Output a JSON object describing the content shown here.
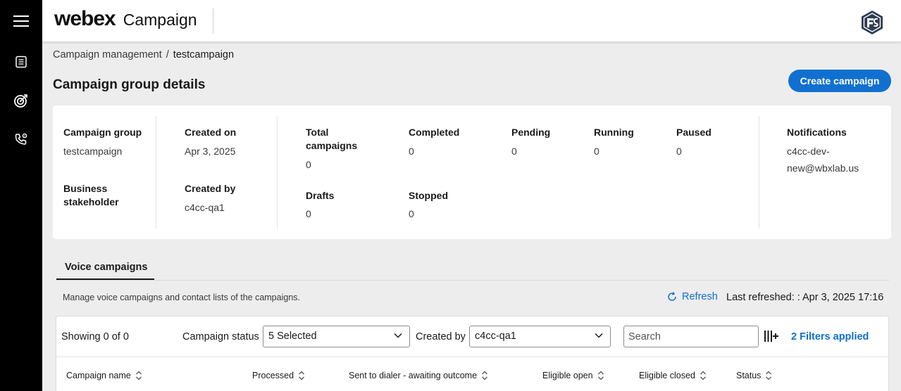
{
  "app": {
    "logo": "webex",
    "product": "Campaign"
  },
  "rail": {
    "items": [
      {
        "icon": "menu-icon"
      },
      {
        "icon": "list-icon"
      },
      {
        "icon": "target-icon"
      },
      {
        "icon": "phone-settings-icon"
      }
    ]
  },
  "breadcrumb": {
    "parent": "Campaign management",
    "separator": "/",
    "current": "testcampaign"
  },
  "page": {
    "title": "Campaign group details",
    "create_button": "Create campaign"
  },
  "details": {
    "campaign_group_label": "Campaign group",
    "campaign_group_value": "testcampaign",
    "business_stakeholder_label_1": "Business",
    "business_stakeholder_label_2": "stakeholder",
    "created_on_label": "Created on",
    "created_on_value": "Apr 3, 2025",
    "created_by_label": "Created by",
    "created_by_value": "c4cc-qa1",
    "total_label_1": "Total",
    "total_label_2": "campaigns",
    "total_value": "0",
    "completed_label": "Completed",
    "completed_value": "0",
    "pending_label": "Pending",
    "pending_value": "0",
    "running_label": "Running",
    "running_value": "0",
    "paused_label": "Paused",
    "paused_value": "0",
    "drafts_label": "Drafts",
    "drafts_value": "0",
    "stopped_label": "Stopped",
    "stopped_value": "0",
    "notifications_label": "Notifications",
    "notifications_value_1": "c4cc-dev-",
    "notifications_value_2": "new@wbxlab.us"
  },
  "tabs": {
    "active": "Voice campaigns"
  },
  "list": {
    "description": "Manage voice campaigns and contact lists of the campaigns.",
    "refresh_label": "Refresh",
    "last_refreshed": "Last refreshed: : Apr 3, 2025 17:16",
    "showing": "Showing 0 of 0",
    "status_filter_label": "Campaign status",
    "status_filter_value": "5 Selected",
    "created_by_filter_label": "Created by",
    "created_by_filter_value": "c4cc-qa1",
    "search_placeholder": "Search",
    "filters_applied": "2 Filters applied",
    "columns": [
      "Campaign name",
      "Processed",
      "Sent to dialer - awaiting outcome",
      "Eligible open",
      "Eligible closed",
      "Status"
    ]
  },
  "colors": {
    "accent": "#1170cf",
    "rail": "#000000",
    "background": "#ededed"
  }
}
